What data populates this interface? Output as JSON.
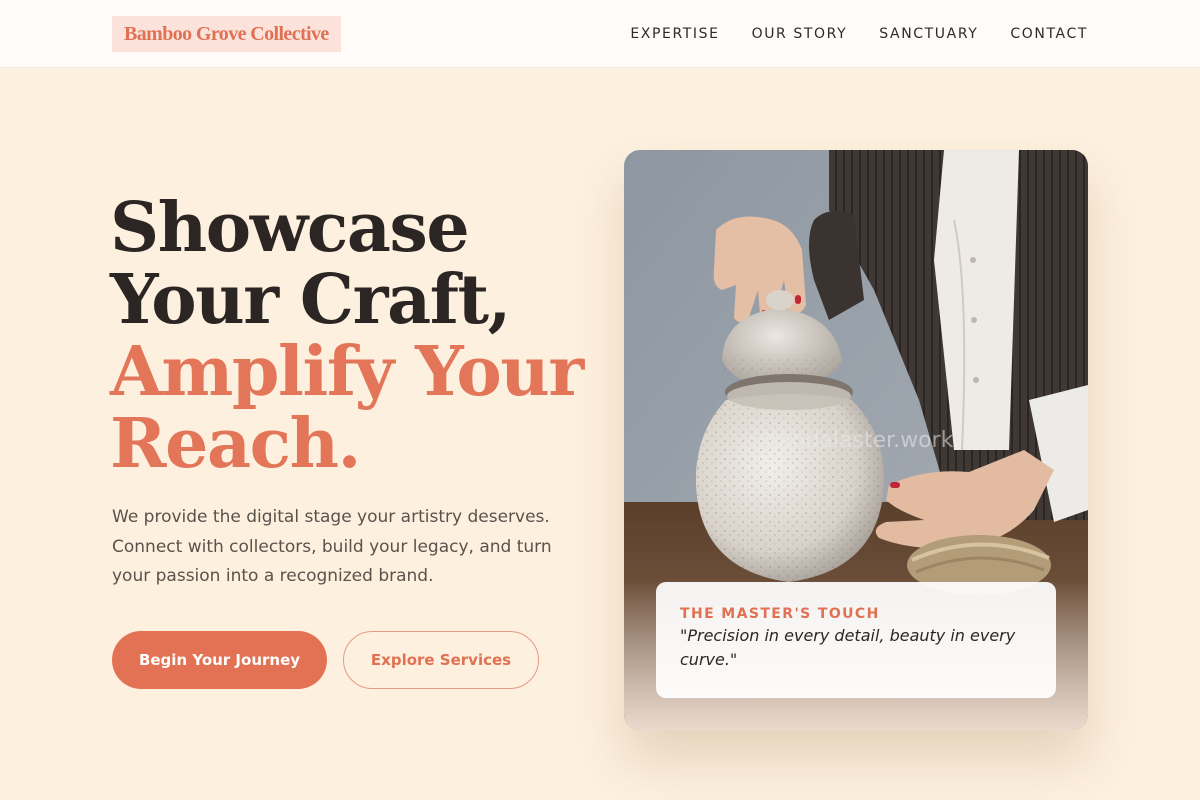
{
  "brand": {
    "name": "Bamboo Grove Collective"
  },
  "nav": {
    "items": [
      "EXPERTISE",
      "OUR STORY",
      "SANCTUARY",
      "CONTACT"
    ]
  },
  "hero": {
    "headline_dark": [
      "Showcase",
      "Your Craft,"
    ],
    "headline_accent": [
      "Amplify Your",
      "Reach."
    ],
    "body": "We provide the digital stage your artistry deserves. Connect with collectors, build your legacy, and turn your passion into a recognized brand.",
    "primary_cta": "Begin Your Journey",
    "secondary_cta": "Explore Services"
  },
  "image": {
    "watermark": "bandalaster.work"
  },
  "quote": {
    "title": "THE MASTER'S TOUCH",
    "text": "\"Precision in every detail, beauty in every curve.\""
  },
  "colors": {
    "accent": "#e37558",
    "background": "#fdf0de",
    "dark_text": "#2b2624"
  }
}
